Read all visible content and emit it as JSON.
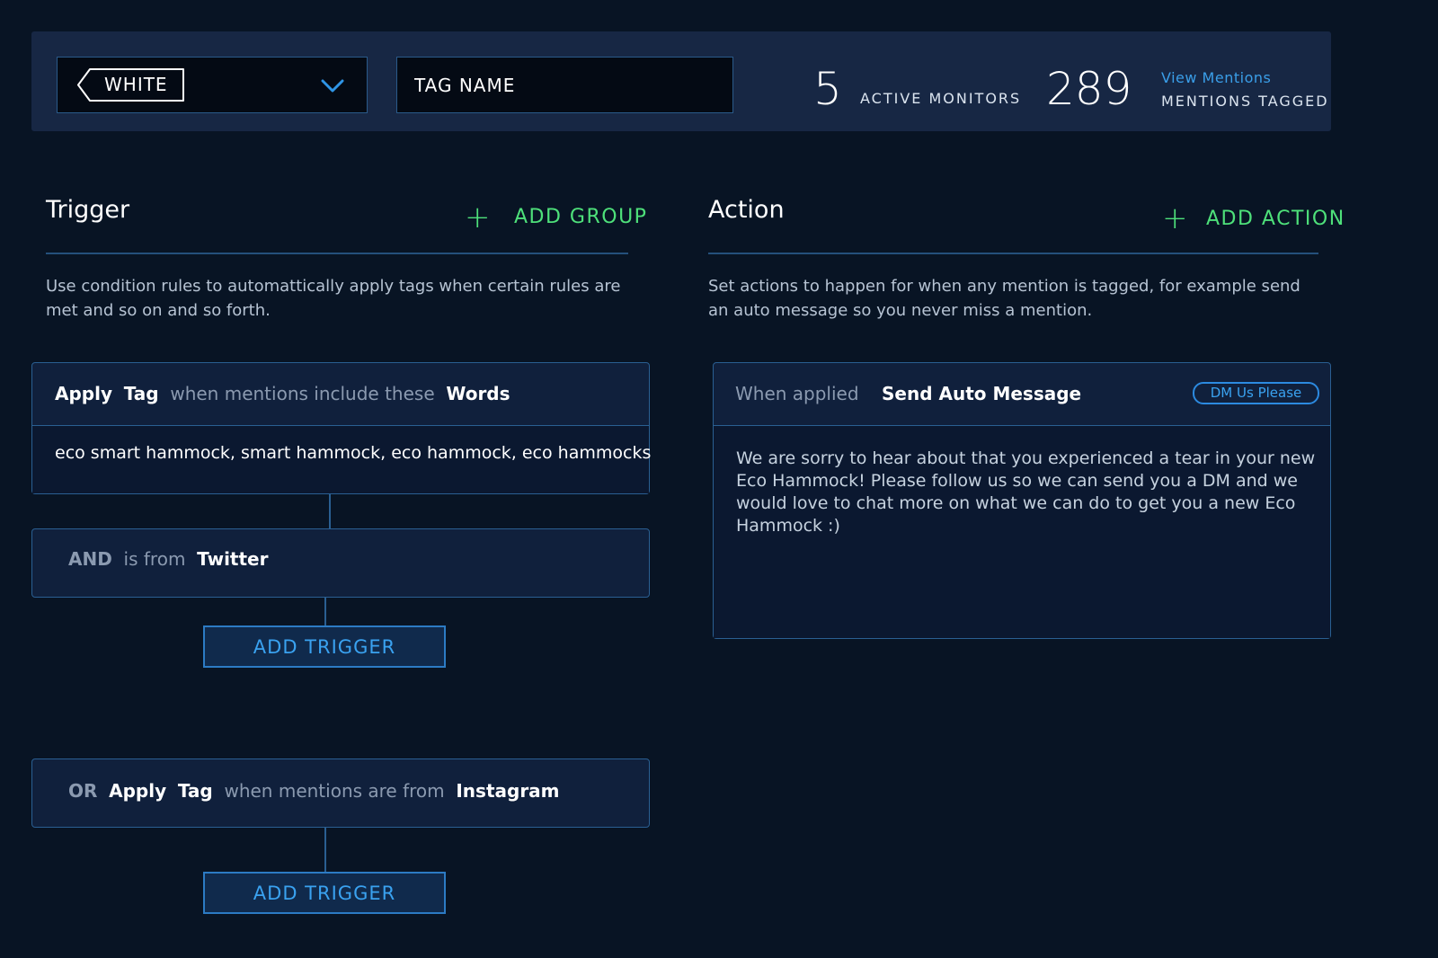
{
  "header": {
    "tag_color": "WHITE",
    "tag_name_placeholder": "TAG NAME",
    "active_monitors_count": "5",
    "active_monitors_label": "ACTIVE MONITORS",
    "mentions_tagged_count": "289",
    "view_mentions_link": "View Mentions",
    "mentions_tagged_label": "MENTIONS TAGGED"
  },
  "trigger": {
    "title": "Trigger",
    "add_group_label": "ADD GROUP",
    "description": "Use condition rules to automattically apply tags when certain rules are met and so on and so forth.",
    "group1": {
      "apply": "Apply",
      "tag": "Tag",
      "condition": "when mentions include these",
      "field": "Words",
      "words": "eco smart hammock, smart hammock, eco hammock, eco hammocks",
      "and_label": "AND",
      "and_condition": "is from",
      "and_source": "Twitter",
      "add_trigger_label": "ADD TRIGGER"
    },
    "group2": {
      "or_label": "OR",
      "apply": "Apply",
      "tag": "Tag",
      "condition": "when mentions are from",
      "source": "Instagram",
      "add_trigger_label": "ADD TRIGGER"
    }
  },
  "action": {
    "title": "Action",
    "add_action_label": "ADD ACTION",
    "description": "Set actions to happen for when any mention is tagged, for example send an auto message so you never miss a mention.",
    "card": {
      "when_label": "When applied",
      "action_name": "Send Auto Message",
      "badge": "DM Us Please",
      "message": "We are sorry to hear about that you experienced a tear in your new Eco Hammock!  Please follow us so we can send you a DM and we would love to chat more on what we can do to get you a new Eco Hammock :)"
    }
  },
  "colors": {
    "background": "#081424",
    "header_bg": "#172744",
    "accent_green": "#4ee07a",
    "accent_blue": "#3aa2f0"
  },
  "icons": [
    "tag-shape-icon",
    "chevron-down-icon",
    "plus-icon"
  ]
}
